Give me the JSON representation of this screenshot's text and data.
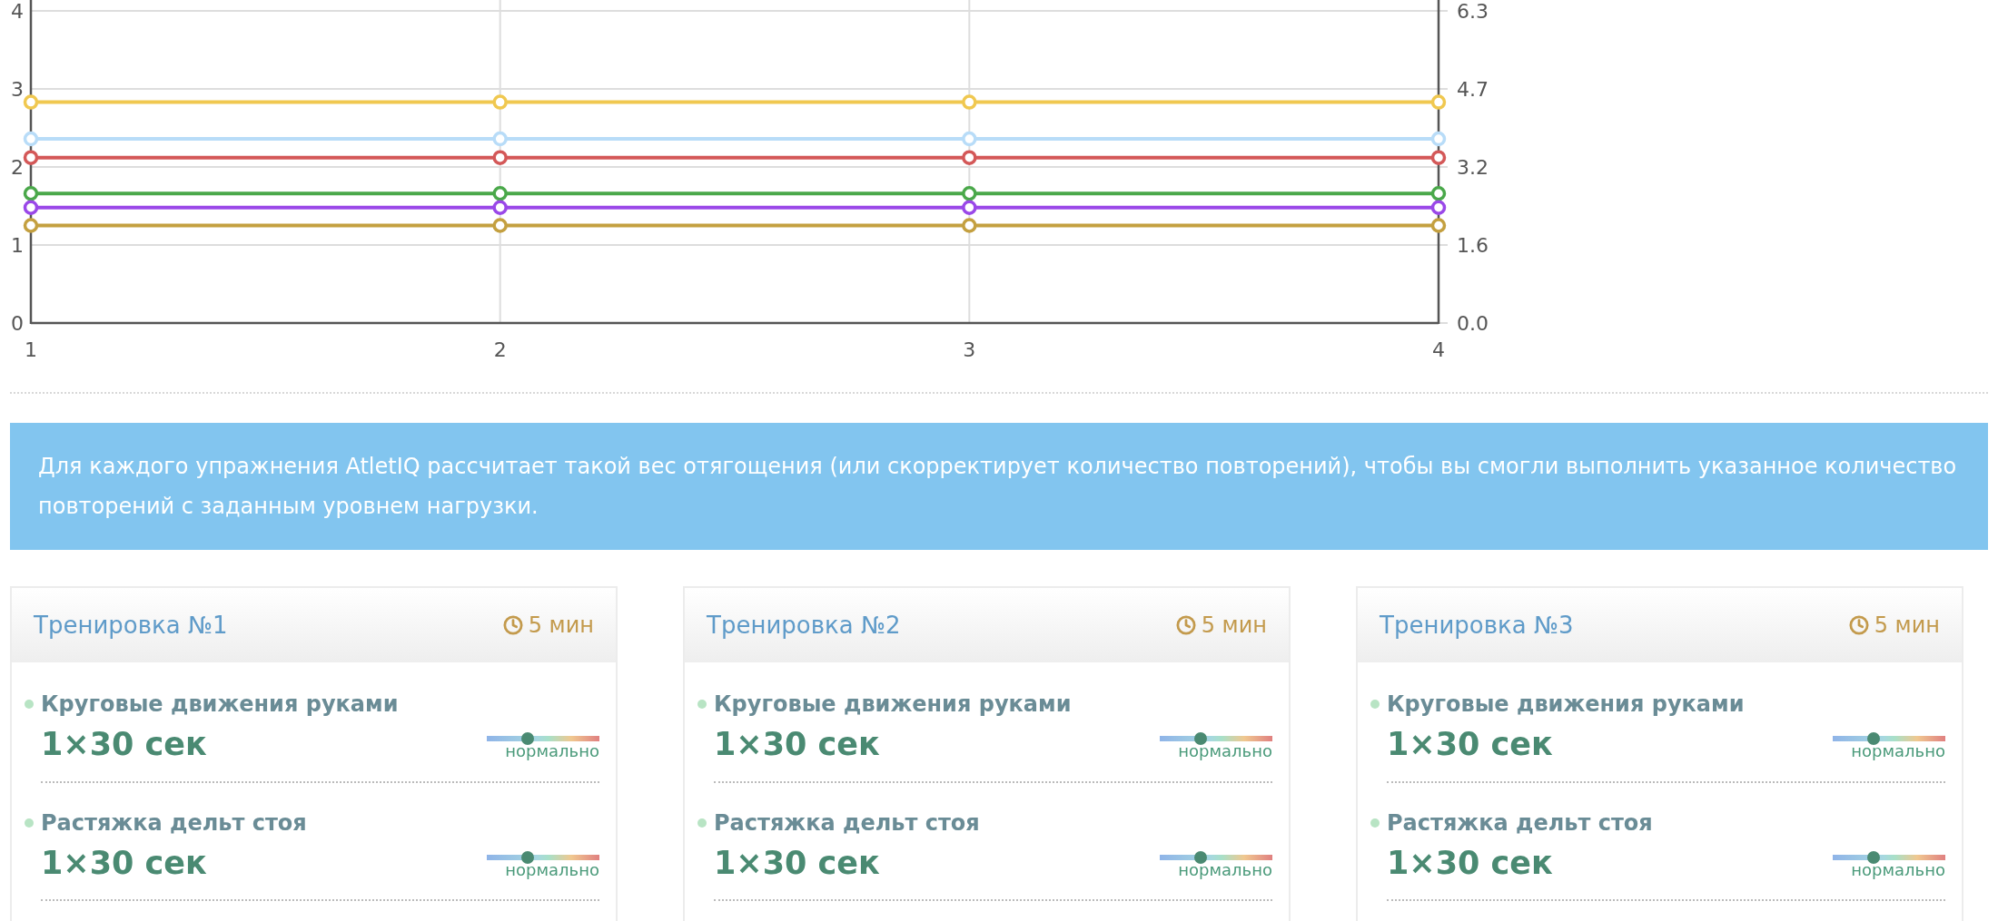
{
  "chart": {
    "chart_data": {
      "type": "line",
      "grid": true,
      "xlim": [
        1,
        4
      ],
      "x": [
        1,
        2,
        3,
        4
      ],
      "xticks": [
        1,
        2,
        3,
        4
      ],
      "ylim": [
        0,
        4
      ],
      "yticks": [
        0,
        1,
        2,
        3,
        4
      ],
      "y2ticks": [
        "0.0",
        "1.6",
        "3.2",
        "4.7",
        "6.3"
      ],
      "series": [
        {
          "marker": "circle",
          "color": "#f0c850",
          "values": [
            2.83,
            2.83,
            2.83,
            2.83
          ]
        },
        {
          "marker": "circle",
          "color": "#b8dcf8",
          "values": [
            2.36,
            2.36,
            2.36,
            2.36
          ]
        },
        {
          "marker": "circle",
          "color": "#d45858",
          "values": [
            2.12,
            2.12,
            2.12,
            2.12
          ]
        },
        {
          "marker": "circle",
          "color": "#4aa84a",
          "values": [
            1.66,
            1.66,
            1.66,
            1.66
          ]
        },
        {
          "marker": "circle",
          "color": "#9a48e8",
          "values": [
            1.48,
            1.48,
            1.48,
            1.48
          ]
        },
        {
          "marker": "circle",
          "color": "#c4a040",
          "values": [
            1.25,
            1.25,
            1.25,
            1.25
          ]
        }
      ]
    }
  },
  "info_banner": "Для каждого упражнения AtletIQ рассчитает такой вес отягощения (или скорректирует количество повторений), чтобы вы смогли выполнить указанное количество повторений с заданным уровнем нагрузки.",
  "workouts": [
    {
      "title": "Тренировка №1",
      "duration": "5 мин",
      "exercises": [
        {
          "name": "Круговые движения руками",
          "amount": "1×30 сек",
          "intensity": {
            "level": 0.36,
            "label": "нормально"
          }
        },
        {
          "name": "Растяжка дельт стоя",
          "amount": "1×30 сек",
          "intensity": {
            "level": 0.36,
            "label": "нормально"
          }
        }
      ]
    },
    {
      "title": "Тренировка №2",
      "duration": "5 мин",
      "exercises": [
        {
          "name": "Круговые движения руками",
          "amount": "1×30 сек",
          "intensity": {
            "level": 0.36,
            "label": "нормально"
          }
        },
        {
          "name": "Растяжка дельт стоя",
          "amount": "1×30 сек",
          "intensity": {
            "level": 0.36,
            "label": "нормально"
          }
        }
      ]
    },
    {
      "title": "Тренировка №3",
      "duration": "5 мин",
      "exercises": [
        {
          "name": "Круговые движения руками",
          "amount": "1×30 сек",
          "intensity": {
            "level": 0.36,
            "label": "нормально"
          }
        },
        {
          "name": "Растяжка дельт стоя",
          "amount": "1×30 сек",
          "intensity": {
            "level": 0.36,
            "label": "нормально"
          }
        }
      ]
    }
  ]
}
